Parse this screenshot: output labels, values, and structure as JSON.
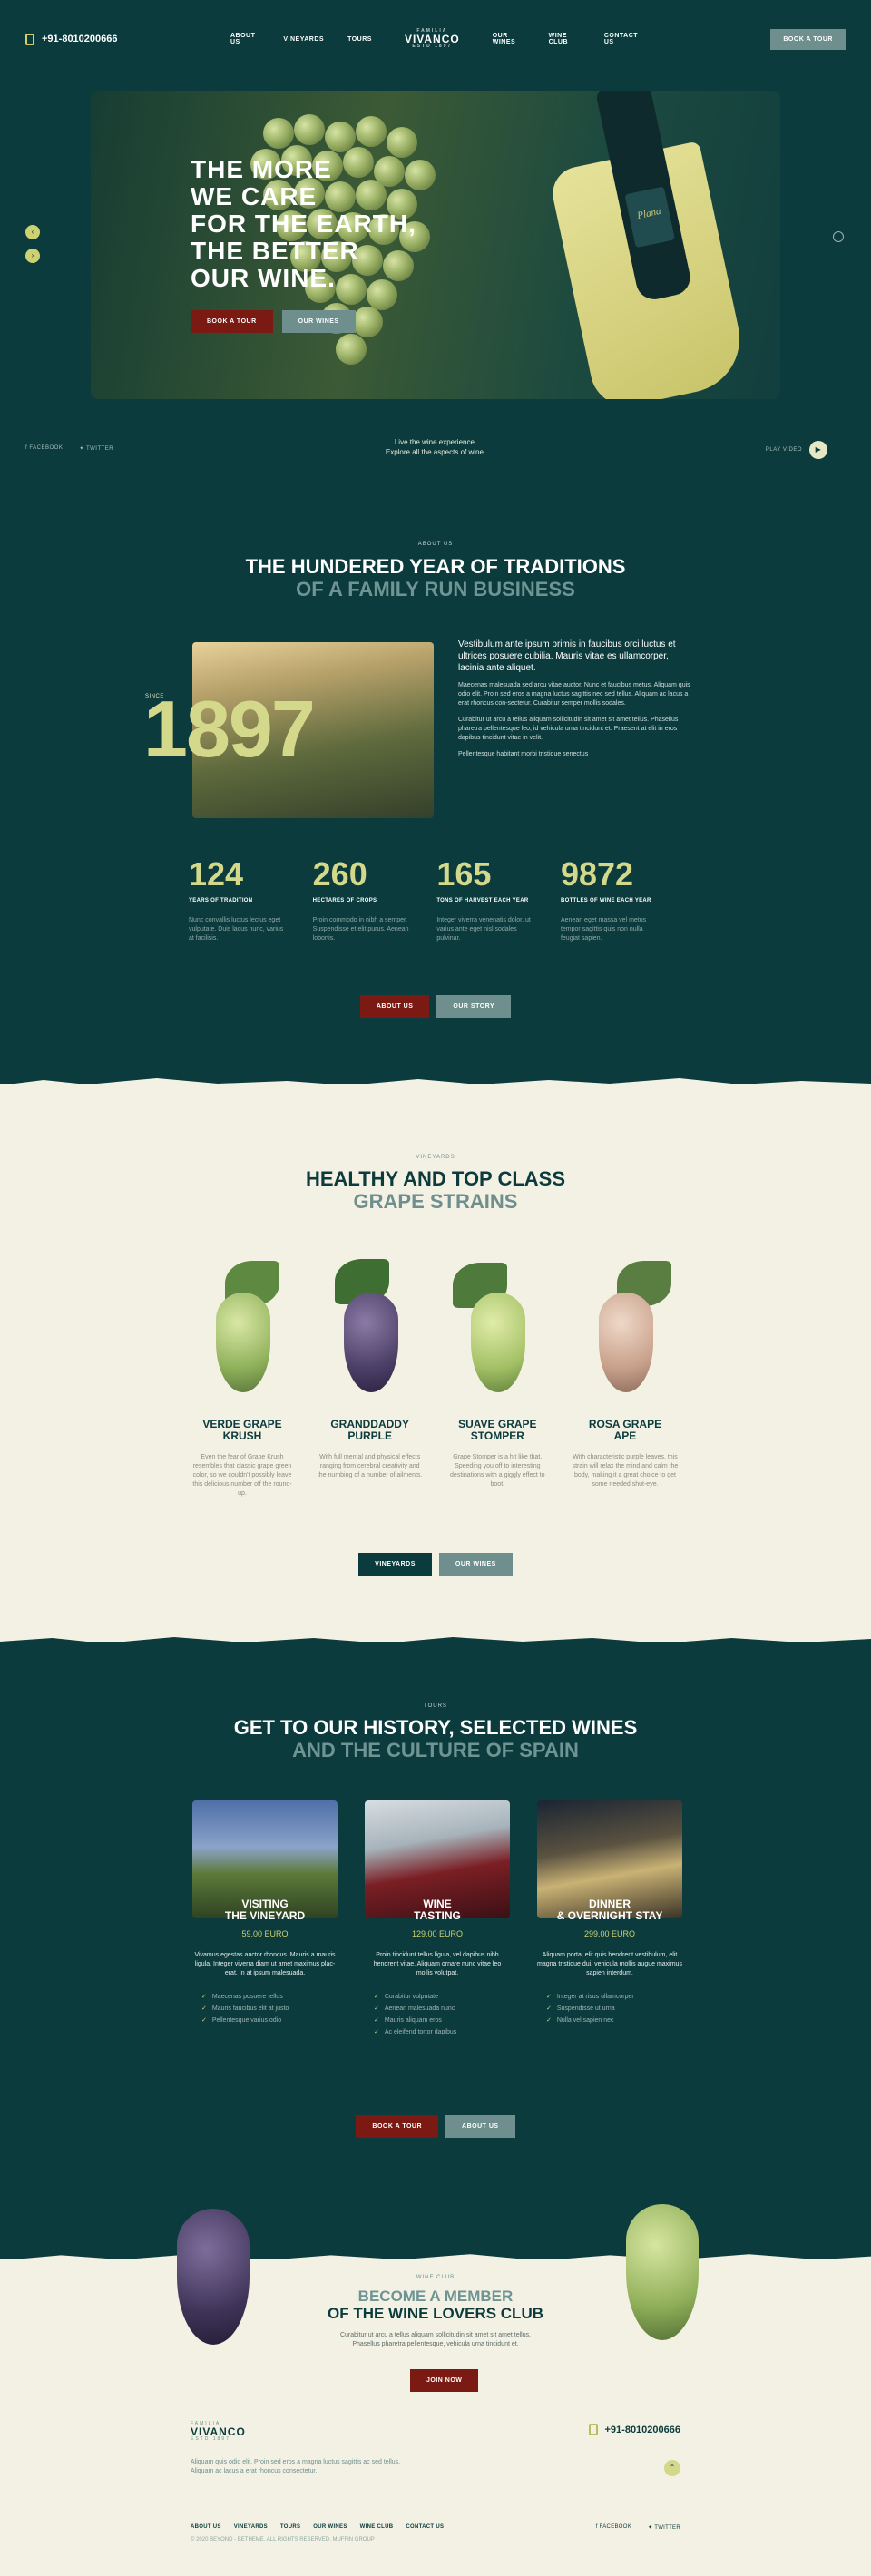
{
  "header": {
    "phone": "+91-8010200666",
    "nav": [
      "ABOUT US",
      "VINEYARDS",
      "TOURS",
      "OUR WINES",
      "WINE CLUB",
      "CONTACT US"
    ],
    "brand_top": "FAMILIA",
    "brand_name": "VIVANCO",
    "brand_sub": "ESTD 1897",
    "book_button": "BOOK A TOUR"
  },
  "hero": {
    "title_lines": [
      "THE MORE",
      "WE CARE",
      "FOR THE EARTH,",
      "THE BETTER",
      "OUR WINE."
    ],
    "book_button": "BOOK A TOUR",
    "wines_button": "OUR WINES",
    "bottle_label": "Plana",
    "caption_line1": "Live the wine experience.",
    "caption_line2": "Explore all the aspects of wine.",
    "social_facebook": "FACEBOOK",
    "social_twitter": "TWITTER",
    "play_video": "PLAY VIDEO"
  },
  "about": {
    "tag": "ABOUT US",
    "title_line1": "THE HUNDERED YEAR OF TRADITIONS",
    "title_line2": "OF A FAMILY RUN BUSINESS",
    "since_label": "SINCE",
    "since_year": "1897",
    "lead": "Vestibulum ante ipsum primis in faucibus orci luctus et ultrices posuere cubilia. Mauris vitae es ullamcorper, lacinia ante aliquet.",
    "p1": "Maecenas malesuada sed arcu vitae auctor. Nunc et faucibus metus. Aliquam quis odio elit. Proin sed eros a magna luctus sagittis nec sed tellus. Aliquam ac lacus a erat rhoncus con-sectetur. Curabitur semper mollis sodales.",
    "p2": "Curabitur ut arcu a tellus aliquam sollicitudin sit amet sit amet tellus. Phasellus pharetra pellentesque leo, id vehicula urna tincidunt et. Praesent at elit in eros dapibus tincidunt vitae in velit.",
    "p3": "Pellentesque habitant morbi tristique senectus",
    "stats": [
      {
        "num": "124",
        "label": "YEARS OF TRADITION",
        "desc": "Nunc convallis luctus lectus eget vulputate. Duis lacus nunc, varius at facilisis."
      },
      {
        "num": "260",
        "label": "HECTARES OF CROPS",
        "desc": "Proin commodo in nibh a semper. Suspendisse et elit purus. Aenean lobortis."
      },
      {
        "num": "165",
        "label": "TONS OF HARVEST EACH YEAR",
        "desc": "Integer viverra venenatis dolor, ut varius ante eget nisl sodales pulvinar."
      },
      {
        "num": "9872",
        "label": "BOTTLES OF WINE EACH YEAR",
        "desc": "Aenean eget massa vel metus tempor sagittis quis non nulla feugiat sapien."
      }
    ],
    "btn_about": "ABOUT US",
    "btn_story": "OUR STORY"
  },
  "strains": {
    "tag": "VINEYARDS",
    "title_line1": "HEALTHY AND TOP CLASS",
    "title_line2": "GRAPE STRAINS",
    "items": [
      {
        "name_l1": "VERDE GRAPE",
        "name_l2": "KRUSH",
        "desc": "Even the fear of Grape Krush resembles that classic grape green color, so we couldn't possibly leave this delicious number off the round-up."
      },
      {
        "name_l1": "GRANDDADDY",
        "name_l2": "PURPLE",
        "desc": "With full mental and physical effects ranging from cerebral creativity and the numbing of a number of ailments."
      },
      {
        "name_l1": "SUAVE GRAPE",
        "name_l2": "STOMPER",
        "desc": "Grape Stomper is a hit like that. Speeding you off to interesting destinations with a giggly effect to boot."
      },
      {
        "name_l1": "ROSA GRAPE",
        "name_l2": "APE",
        "desc": "With characteristic purple leaves, this strain will relax the mind and calm the body, making it a great choice to get some needed shut-eye."
      }
    ],
    "btn_vineyards": "VINEYARDS",
    "btn_wines": "OUR WINES"
  },
  "tours": {
    "tag": "TOURS",
    "title_line1": "GET TO OUR HISTORY, SELECTED WINES",
    "title_line2": "AND THE CULTURE OF SPAIN",
    "items": [
      {
        "name_l1": "VISITING",
        "name_l2": "THE VINEYARD",
        "price": "59.00 EURO",
        "desc": "Vivamus egestas auctor rhoncus. Mauris a mauris ligula. Integer viverra diam ut amet maximus plac-erat. In at ipsum malesuada.",
        "list": [
          "Maecenas posuere tellus",
          "Mauris faucibus elit at justo",
          "Pellentesque varius odio"
        ]
      },
      {
        "name_l1": "WINE",
        "name_l2": "TASTING",
        "price": "129.00 EURO",
        "desc": "Proin tincidunt tellus ligula, vel dapibus nibh hendrerit vitae. Aliquam ornare nunc vitae leo mollis volutpat.",
        "list": [
          "Curabitur vulputate",
          "Aenean malesuada nunc",
          "Mauris aliquam eros",
          "Ac eleifend tortor dapibus"
        ]
      },
      {
        "name_l1": "DINNER",
        "name_l2": "& OVERNIGHT STAY",
        "price": "299.00 EURO",
        "desc": "Aliquam porta, elit quis hendrerit vestibulum, elit magna tristique dui, vehicula mollis augue maximus sapien interdum.",
        "list": [
          "Integer at risus ullamcorper",
          "Suspendisse ut urna",
          "Nulla vel sapien nec"
        ]
      }
    ],
    "btn_book": "BOOK A TOUR",
    "btn_about": "ABOUT US"
  },
  "club": {
    "tag": "WINE CLUB",
    "title_line1": "BECOME A MEMBER",
    "title_line2": "OF THE WINE LOVERS CLUB",
    "desc_line1": "Curabitur ut arcu a tellus aliquam sollicitudin sit amet sit amet tellus.",
    "desc_line2": "Phasellus pharetra pellentesque, vehicula urna tincidunt et.",
    "btn_join": "JOIN NOW"
  },
  "footer": {
    "brand_top": "FAMILIA",
    "brand_name": "VIVANCO",
    "brand_sub": "ESTD 1897",
    "phone": "+91-8010200666",
    "text": "Aliquam quis odio elit. Proin sed eros a magna luctus sagittis ac sed tellus. Aliquam ac lacus a erat rhoncus consectetur.",
    "nav": [
      "ABOUT US",
      "VINEYARDS",
      "TOURS",
      "OUR WINES",
      "WINE CLUB",
      "CONTACT US"
    ],
    "copyright": "© 2020 BEYOND - BETHEME. ALL RIGHTS RESERVED. MUFFIN GROUP",
    "social_facebook": "FACEBOOK",
    "social_twitter": "TWITTER"
  },
  "colors": {
    "teal": "#0c3b3d",
    "cream": "#f3f1e3",
    "accent_yellow": "#d4d88a",
    "red": "#7a1a12",
    "slate": "#6e8f8e"
  }
}
